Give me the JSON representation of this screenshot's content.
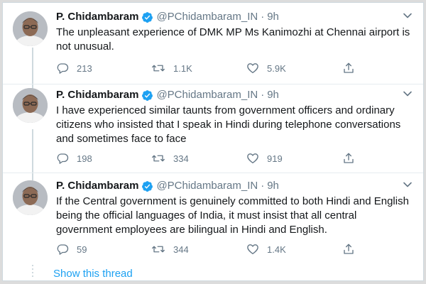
{
  "thread": {
    "show_thread_label": "Show this thread"
  },
  "icons": {
    "reply": "reply-icon",
    "retweet": "retweet-icon",
    "like": "heart-icon",
    "share": "share-icon",
    "verified": "verified-badge-icon",
    "more": "chevron-down-icon"
  },
  "colors": {
    "link": "#1da1f2",
    "muted": "#657786",
    "text": "#14171a",
    "verified": "#1da1f2"
  },
  "tweets": [
    {
      "author_name": "P. Chidambaram",
      "handle": "@PChidambaram_IN",
      "separator": "·",
      "time": "9h",
      "lines": [
        "The unpleasant experience of DMK MP Ms Kanimozhi at Chennai airport is",
        "not unusual."
      ],
      "replies": "213",
      "retweets": "1.1K",
      "likes": "5.9K"
    },
    {
      "author_name": "P. Chidambaram",
      "handle": "@PChidambaram_IN",
      "separator": "·",
      "time": "9h",
      "lines": [
        "I have experienced similar taunts from government officers and ordinary",
        "citizens who insisted that I speak in Hindi during telephone conversations",
        "and sometimes face to face"
      ],
      "replies": "198",
      "retweets": "334",
      "likes": "919"
    },
    {
      "author_name": "P. Chidambaram",
      "handle": "@PChidambaram_IN",
      "separator": "·",
      "time": "9h",
      "lines": [
        "If the Central government is genuinely committed to both Hindi and English",
        "being the official languages of India, it must insist that all central",
        "government employees are bilingual in Hindi and English."
      ],
      "replies": "59",
      "retweets": "344",
      "likes": "1.4K"
    }
  ]
}
